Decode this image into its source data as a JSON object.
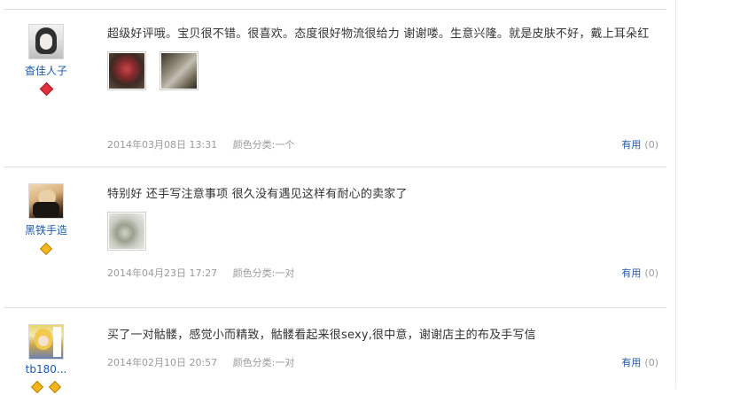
{
  "reviews": [
    {
      "username": "杳佳人子",
      "text": "超级好评哦。宝贝很不错。很喜欢。态度很好物流很给力 谢谢喽。生意兴隆。就是皮肤不好，戴上耳朵红",
      "date": "2014年03月08日 13:31",
      "sku": "颜色分类:一个",
      "useful_label": "有用",
      "useful_count": "(0)"
    },
    {
      "username": "黑铁手造",
      "text": "特别好 还手写注意事项 很久没有遇见这样有耐心的卖家了",
      "date": "2014年04月23日 17:27",
      "sku": "颜色分类:一对",
      "useful_label": "有用",
      "useful_count": "(0)"
    },
    {
      "username": "tb180...",
      "text": "买了一对骷髅，感觉小而精致，骷髅看起来很sexy,很中意，谢谢店主的布及手写信",
      "date": "2014年02月10日 20:57",
      "sku": "颜色分类:一对",
      "useful_label": "有用",
      "useful_count": "(0)"
    }
  ]
}
